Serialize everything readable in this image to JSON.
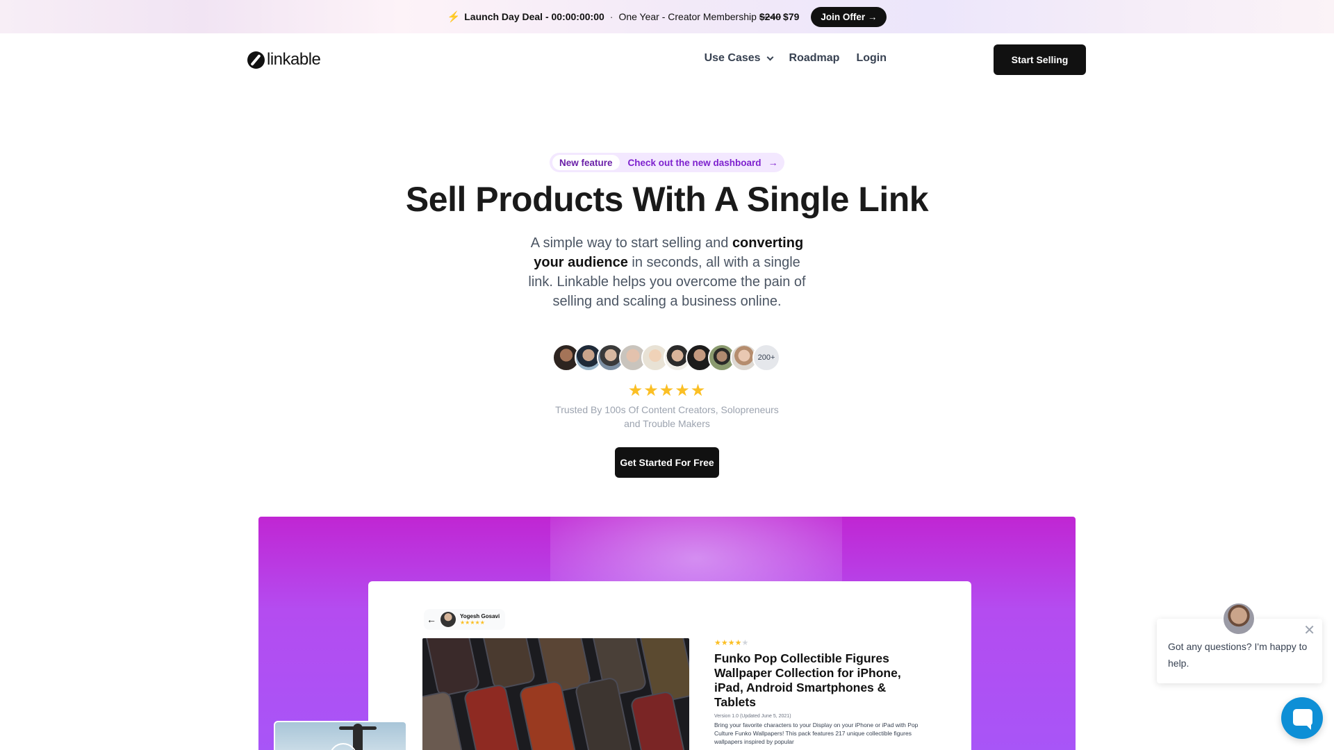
{
  "announcement": {
    "deal_label": "Launch Day Deal - 00:00:00:00",
    "separator": "·",
    "offer_text": "One Year - Creator Membership",
    "old_price": "$240",
    "new_price": "$79",
    "join_button": "Join Offer →"
  },
  "nav": {
    "logo_text": "linkable",
    "links": [
      "Use Cases",
      "Roadmap",
      "Login"
    ],
    "start_button": "Start Selling"
  },
  "hero": {
    "pill_tag": "New feature",
    "pill_message": "Check out the new dashboard",
    "pill_arrow": "→",
    "title": "Sell Products With A Single Link",
    "subtitle_part1": "A simple way to start selling and ",
    "subtitle_bold": "converting your audience",
    "subtitle_part2": " in seconds, all with a single link. Linkable helps you overcome the pain of selling and scaling a business online.",
    "avatar_count": "200+",
    "stars": "★★★★★",
    "trusted_text": "Trusted By 100s Of Content Creators, Solopreneurs and Trouble Makers",
    "cta_button": "Get Started For Free"
  },
  "showcase": {
    "seller_back": "←",
    "seller_name": "Yogesh Gosavi",
    "seller_stars": "★★★★★",
    "product_stars_filled": "★★★★",
    "product_stars_empty": "★",
    "product_title": "Funko Pop Collectible Figures Wallpaper Collection for iPhone, iPad, Android Smartphones & Tablets",
    "product_version": "Version 1.0 (Updated June 5, 2021)",
    "product_description": "Bring your favorite characters to your Display on your iPhone or iPad with Pop Culture Funko Wallpapers! This pack features 217 unique collectible figures wallpapers inspired by popular"
  },
  "chat": {
    "message": "Got any questions? I'm happy to help.",
    "close": "✕"
  },
  "colors": {
    "accent_purple": "#a855f7",
    "magenta": "#c026d3",
    "dark": "#111111",
    "star": "#fbbf24",
    "chat_blue": "#0e8fd6"
  }
}
